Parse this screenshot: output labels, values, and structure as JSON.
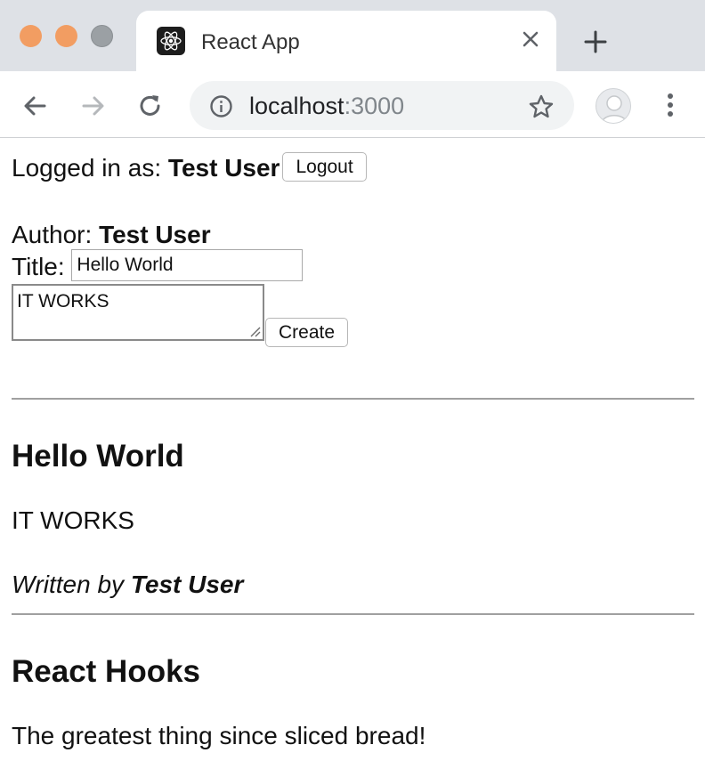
{
  "browser": {
    "tab_title": "React App",
    "url_host": "localhost",
    "url_port": ":3000"
  },
  "user": {
    "logged_in_prefix": "Logged in as: ",
    "name": "Test User",
    "logout_label": "Logout"
  },
  "create_post": {
    "author_prefix": "Author: ",
    "author_name": "Test User",
    "title_label": "Title: ",
    "title_value": "Hello World",
    "content_value": "IT WORKS",
    "create_label": "Create"
  },
  "posts": [
    {
      "title": "Hello World",
      "content": "IT WORKS",
      "byline_prefix": "Written by ",
      "author": "Test User"
    },
    {
      "title": "React Hooks",
      "content": "The greatest thing since sliced bread!"
    }
  ]
}
